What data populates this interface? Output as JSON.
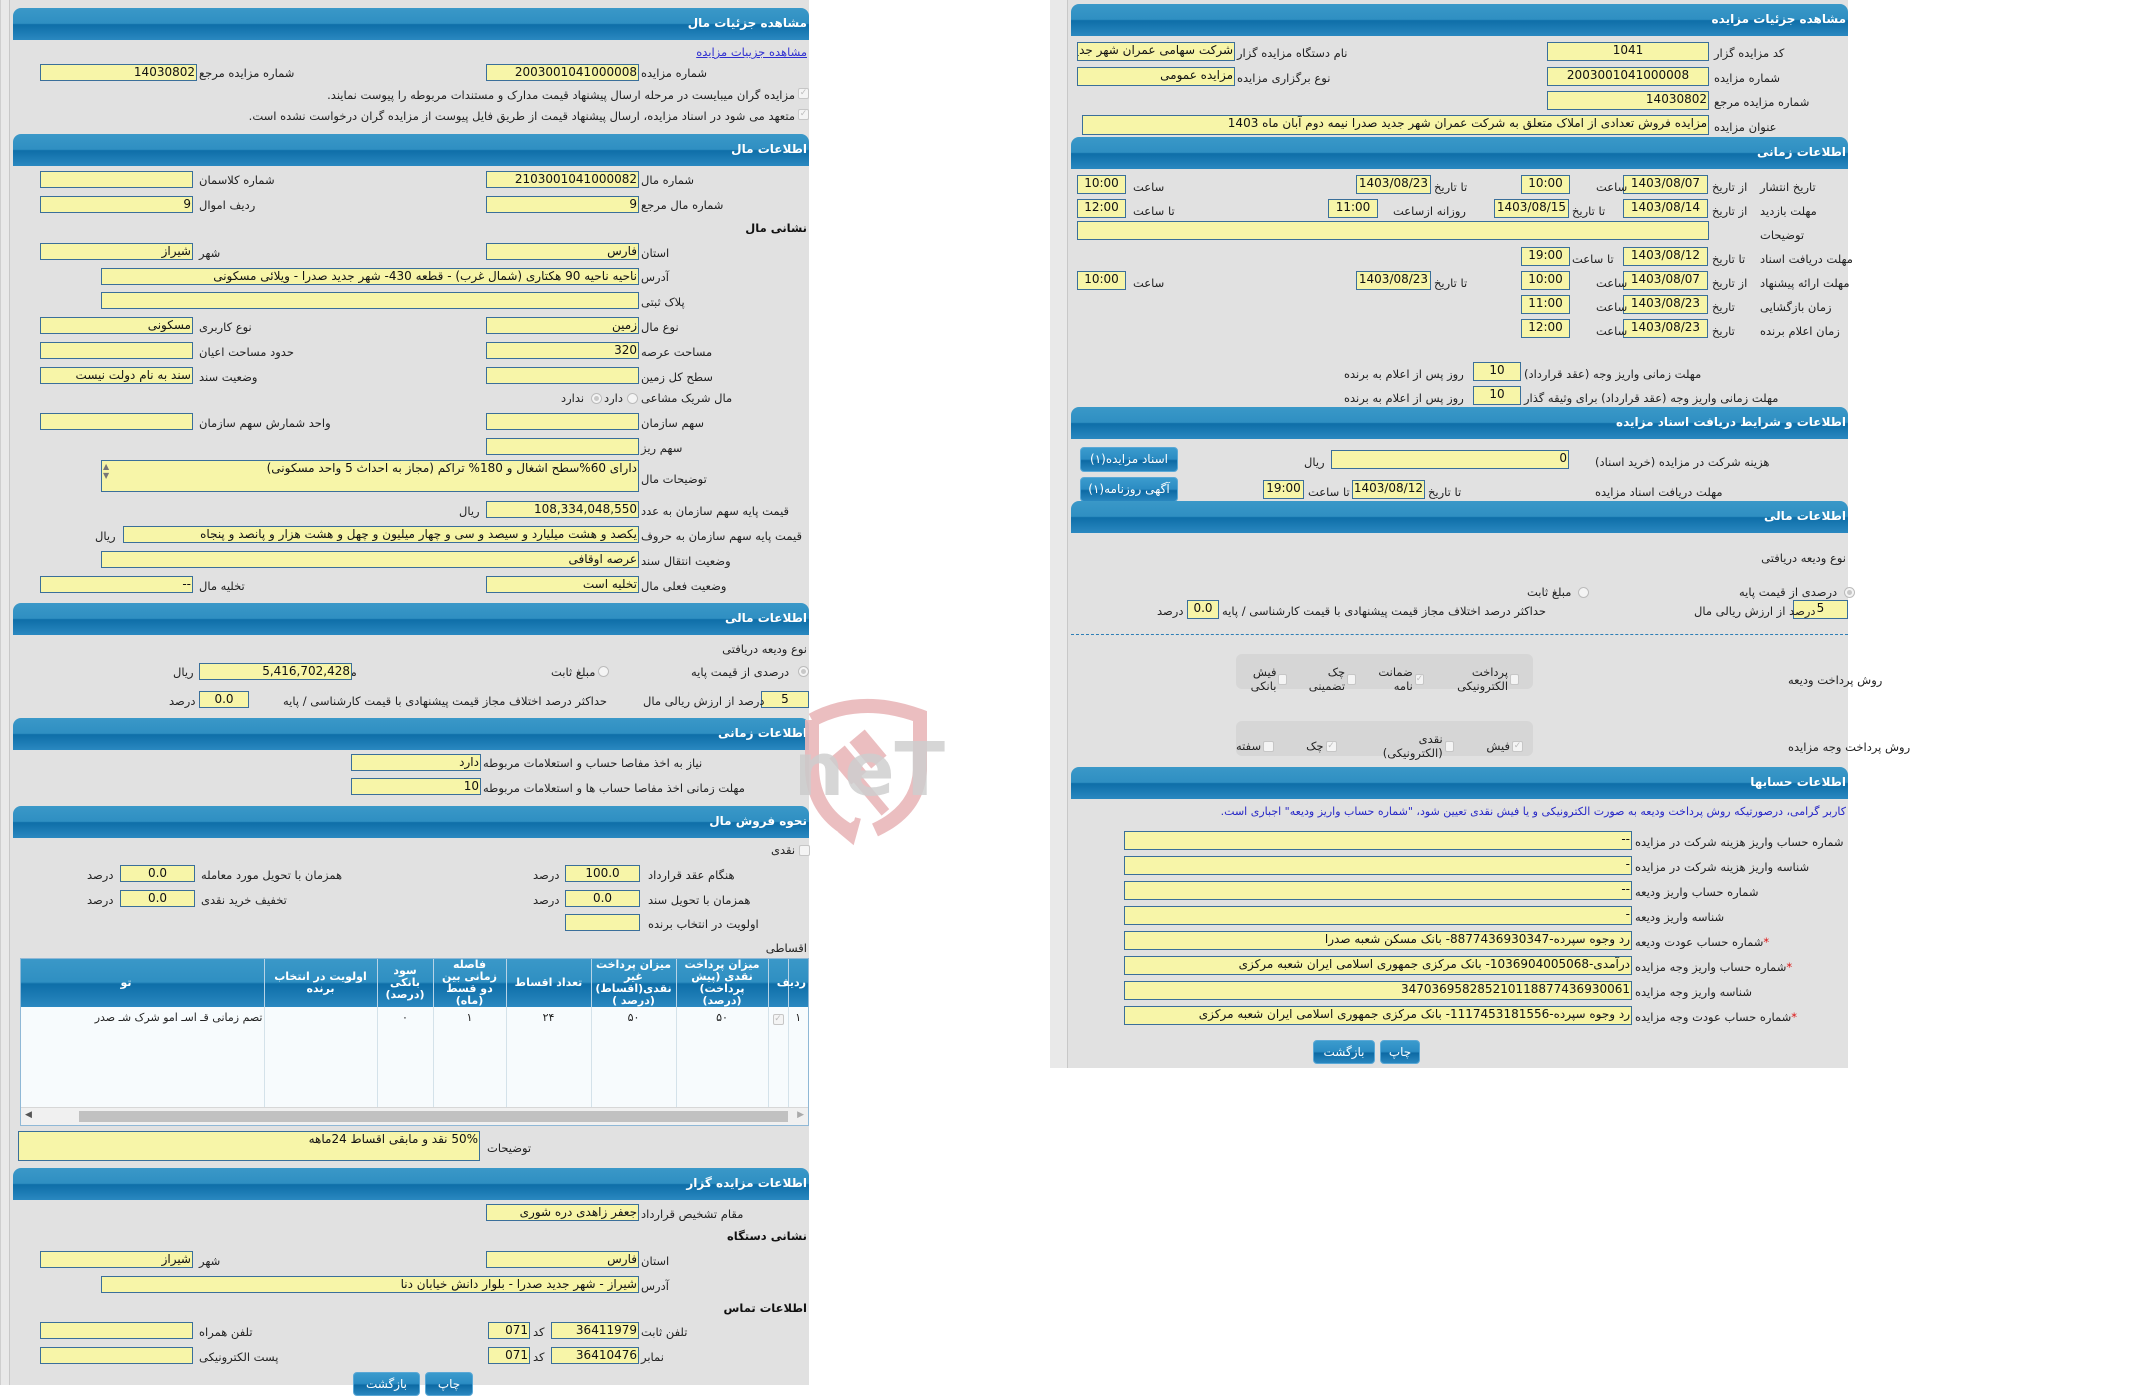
{
  "left": {
    "sections": {
      "item_details": "مشاهده جزئیات مال",
      "item_info": "اطلاعات مال",
      "financial": "اطلاعات مالی",
      "timing": "اطلاعات زمانی",
      "sale_method": "نحوه فروش مال",
      "auctioneer": "اطلاعات مزایده گزار"
    },
    "view_auction_link": "مشاهده جزییات مزایده",
    "auction_number_label": "شماره مزایده",
    "auction_number": "2003001041000008",
    "ref_number_label": "شماره مزایده مرجع",
    "ref_number": "14030802",
    "checkbox1": "مزایده گران میبایست در مرحله ارسال پیشنهاد قیمت مدارک و مستندات مربوطه را پیوست نمایند.",
    "checkbox2": "متعهد می شود در اسناد مزایده، ارسال پیشنهاد قیمت از طریق فایل پیوست از مزایده گران درخواست نشده است.",
    "item": {
      "item_number_label": "شماره مال",
      "item_number": "2103001041000082",
      "classman_label": "شماره کلاسمان",
      "classman": "",
      "ref_item_label": "شماره مال مرجع",
      "ref_item": "9",
      "row_label": "ردیف اموال",
      "row": "9",
      "address_heading": "نشانی مال",
      "province_label": "استان",
      "province": "فارس",
      "city_label": "شهر",
      "city": "شیراز",
      "address_label": "آدرس",
      "address": "ناحیه ناحیه 90 هکتاری (شمال غرب) - قطعه 430- شهر جدید صدرا - ویلائی مسکونی",
      "plaque_label": "پلاک ثبتی",
      "plaque": "",
      "type_label": "نوع مال",
      "type": "زمین",
      "usage_label": "نوع کاربری",
      "usage": "مسکونی",
      "area_label": "مساحت عرصه",
      "area": "320",
      "building_area_label": "حدود مساحت اعیان",
      "building_area": "",
      "land_level_label": "سطح کل زمین",
      "land_level": "",
      "deed_status_label": "وضعیت سند",
      "deed_status": "سند به نام دولت نیست",
      "partner_label": "مال شریک مشاعی",
      "partner_yes": "دارد",
      "partner_no": "ندارد",
      "org_share_label": "سهم سازمان",
      "org_share": "",
      "share_unit_label": "واحد شمارش سهم سازمان",
      "share_unit": "",
      "fine_share_label": "سهم ریز",
      "fine_share": "",
      "desc_label": "توضیحات مال",
      "desc": "دارای 60%سطح اشغال و  180% تراکم (مجاز به احداث 5 واحد مسکونی)",
      "base_price_num_label": "قیمت پایه سهم سازمان به عدد",
      "base_price_num": "108,334,048,550",
      "rial": "ریال",
      "base_price_words_label": "قیمت پایه سهم سازمان به حروف",
      "base_price_words": "یکصد و هشت میلیارد و سیصد و سی و چهار میلیون و چهل و هشت هزار و پانصد و پنجاه",
      "transfer_label": "وضعیت انتقال سند",
      "transfer": "عرصه اوقافی",
      "current_status_label": "وضعیت فعلی مال",
      "current_status": "تخلیه است",
      "evacuation_label": "تخلیه مال",
      "evacuation": "--"
    },
    "financial": {
      "deposit_type_label": "نوع ودیعه دریافتی",
      "percent_option": "درصدی از قیمت پایه",
      "fixed_option": "مبلغ ثابت",
      "deposit_amount_label": "مبلغ ریالی ودیعه",
      "deposit_amount": "5,416,702,428",
      "rial": "ریال",
      "percent_value": "5",
      "percent_suffix": "درصد از ارزش ریالی مال",
      "max_diff_label": "حداکثر درصد اختلاف مجاز قیمت پیشنهادی با قیمت کارشناسی / پایه",
      "max_diff": "0.0",
      "percent_word": "درصد"
    },
    "timing": {
      "clearance_label": "نیاز به اخذ مفاصا حساب و استعلامات مربوطه",
      "clearance": "دارد",
      "clearance_deadline_label": "مهلت زمانی اخذ مفاصا حساب ها و استعلامات مربوطه",
      "clearance_deadline": "10"
    },
    "sale": {
      "cash_label": "نقدی",
      "contract_label": "هنگام عقد قرارداد",
      "contract": "100.0",
      "delivery_label": "همزمان با تحویل مورد معامله",
      "delivery": "0.0",
      "deed_label": "همزمان با تحویل سند",
      "deed": "0.0",
      "discount_label": "تخفیف خرید نقدی",
      "discount": "0.0",
      "priority_label": "اولویت در انتخاب برنده",
      "priority": "",
      "percent_word": "درصد",
      "installments_label": "اقساطی",
      "table": {
        "headers": [
          "ردیف",
          "",
          "میزان پرداخت نقدی (پیش پرداخت) (درصد)",
          "میزان پرداخت غیر نقدی(اقساط) (درصد )",
          "تعداد اقساط",
          "فاصله زمانی بین دو قسط (ماه)",
          "سود بانکی (درصد)",
          "اولویت در انتخاب برنده",
          "تو"
        ],
        "rows": [
          [
            "۱",
            "✓",
            "۵۰",
            "۵۰",
            "۲۴",
            "۱",
            "۰",
            "",
            "تصم زمانی قـ اسـ امو شرک شـ صدر"
          ]
        ]
      },
      "desc_label": "توضیحات",
      "desc": "50% نقد و مابقی اقساط 24ماهه"
    },
    "auctioneer": {
      "authority_label": "مقام تشخیص قرارداد",
      "authority": "جعفر زاهدی دره شوری",
      "address_heading": "نشانی دستگاه",
      "province_label": "استان",
      "province": "فارس",
      "city_label": "شهر",
      "city": "شیراز",
      "address_label": "آدرس",
      "address": "شیراز - شهر جدید صدرا - بلوار دانش خیابان دنا",
      "contact_heading": "اطلاعات تماس",
      "phone_label": "تلفن ثابت",
      "phone": "36411979",
      "code_label": "کد",
      "phone_code": "071",
      "mobile_label": "تلفن همراه",
      "mobile": "",
      "fax_label": "نمابر",
      "fax": "36410476",
      "fax_code": "071",
      "email_label": "پست الکترونیکی",
      "email": ""
    },
    "print_button": "چاپ",
    "back_button": "بازگشت"
  },
  "right": {
    "sections": {
      "auction_details": "مشاهده جزئیات مزایده",
      "timing": "اطلاعات زمانی",
      "documents": "اطلاعات و شرایط دریافت اسناد مزایده",
      "financial": "اطلاعات مالی",
      "accounts": "اطلاعات حسابها"
    },
    "details": {
      "auctioneer_code_label": "کد مزایده گزار",
      "auctioneer_code": "1041",
      "org_name_label": "نام دستگاه مزایده گزار",
      "org_name": "شرکت سهامی عمران شهر جدید صدرا",
      "auction_number_label": "شماره مزایده",
      "auction_number": "2003001041000008",
      "auction_type_label": "نوع برگزاری مزایده",
      "auction_type": "مزایده عمومی",
      "ref_number_label": "شماره مزایده مرجع",
      "ref_number": "14030802",
      "title_label": "عنوان مزایده",
      "title": "مزایده فروش تعدادی از املاک متعلق به شرکت عمران شهر جدید صدرا نیمه دوم آبان ماه 1403"
    },
    "timing": {
      "from_date": "از تاریخ",
      "to_date": "تا تاریخ",
      "date": "تاریخ",
      "time": "ساعت",
      "to_time": "تا ساعت",
      "publish_label": "تاریخ انتشار",
      "publish_from": "1403/08/07",
      "publish_from_time": "10:00",
      "publish_to": "1403/08/23",
      "publish_to_time": "10:00",
      "visit_label": "مهلت بازدید",
      "visit_from": "1403/08/14",
      "visit_to": "1403/08/15",
      "daily_from_label": "روزانه ازساعت",
      "daily_from": "11:00",
      "daily_to": "12:00",
      "desc_label": "توضیحات",
      "desc": "",
      "doc_label": "مهلت دریافت اسناد",
      "doc_to": "1403/08/12",
      "doc_to_time": "19:00",
      "offer_label": "مهلت ارائه پیشنهاد",
      "offer_from": "1403/08/07",
      "offer_from_time": "10:00",
      "offer_to": "1403/08/23",
      "offer_to_time": "10:00",
      "opening_label": "زمان بازگشایی",
      "opening": "1403/08/23",
      "opening_time": "11:00",
      "winner_label": "زمان اعلام برنده",
      "winner": "1403/08/23",
      "winner_time": "12:00",
      "payment_deadline_label": "مهلت زمانی واریز وجه (عقد قرارداد)",
      "payment_deadline": "10",
      "guarantee_deadline_label": "مهلت زمانی واریز وجه (عقد قرارداد) برای وثیقه گذار",
      "guarantee_deadline": "10",
      "days_suffix": "روز پس از اعلام به برنده"
    },
    "documents": {
      "fee_label": "هزینه شرکت در مزایده (خرید اسناد)",
      "fee": "0",
      "rial": "ریال",
      "deadline_label": "مهلت دریافت اسناد مزایده",
      "to_date": "تا تاریخ",
      "deadline": "1403/08/12",
      "to_time": "تا ساعت",
      "deadline_time": "19:00",
      "docs_button": "اسناد مزایده(۱)",
      "newspaper_button": "آگهی روزنامه(۱)"
    },
    "financial": {
      "deposit_type_label": "نوع ودیعه دریافتی",
      "percent_option": "درصدی از قیمت پایه",
      "fixed_option": "مبلغ ثابت",
      "percent_value": "5",
      "percent_suffix": "درصد از ارزش ریالی مال",
      "max_diff_label": "حداکثر درصد اختلاف مجاز قیمت پیشنهادی با قیمت کارشناسی / پایه",
      "max_diff": "0.0",
      "percent_word": "درصد",
      "deposit_method_label": "روش پرداخت ودیعه",
      "deposit_methods": [
        {
          "label": "پرداخت الکترونیکی",
          "checked": false
        },
        {
          "label": "ضمانت نامه",
          "checked": true
        },
        {
          "label": "چک تضمینی",
          "checked": false
        },
        {
          "label": "فیش بانکی",
          "checked": false
        }
      ],
      "payment_method_label": "روش پرداخت وجه مزایده",
      "payment_methods": [
        {
          "label": "فیش",
          "checked": true
        },
        {
          "label": "نقدی (الکترونیکی)",
          "checked": false
        },
        {
          "label": "چک",
          "checked": true
        },
        {
          "label": "سفته",
          "checked": false
        }
      ]
    },
    "accounts": {
      "note": "کاربر گرامی، درصورتیکه روش پرداخت ودیعه به صورت الکترونیکی و یا فیش نقدی تعیین شود، \"شماره حساب واریز ودیعه\" اجباری است.",
      "rows": [
        {
          "label": "شماره حساب واریز هزینه شرکت در مزایده",
          "value": "--",
          "required": false
        },
        {
          "label": "شناسه واریز هزینه شرکت در مزایده",
          "value": "-",
          "required": false
        },
        {
          "label": "شماره حساب واریز ودیعه",
          "value": "--",
          "required": false
        },
        {
          "label": "شناسه واریز ودیعه",
          "value": "-",
          "required": false
        },
        {
          "label": "شماره حساب عودت ودیعه",
          "value": "رد وجوه سپرده-8877436930347- بانک مسکن شعبه صدرا",
          "required": true
        },
        {
          "label": "شماره حساب واریز وجه مزایده",
          "value": "درآمدی-1036904005068- بانک مرکزی جمهوری اسلامی ایران شعبه مرکزی",
          "required": true
        },
        {
          "label": "شناسه واریز وجه مزایده",
          "value": "347036958285210118877436930061",
          "required": false
        },
        {
          "label": "شماره حساب عودت وجه مزایده",
          "value": "رد وجوه سپرده-1117453181556- بانک مرکزی جمهوری اسلامی ایران شعبه مرکزی",
          "required": true
        }
      ]
    },
    "print_button": "چاپ",
    "back_button": "بازگشت"
  },
  "watermark": {
    "text": "AriaTender.neT",
    "icon": "gavel-shield-icon"
  },
  "colors": {
    "header": "#2f8fc2",
    "field_bg": "#f7f5a8",
    "field_border": "#3a6f9a",
    "panel_bg": "#e1e1e1",
    "link": "#3030d0"
  }
}
